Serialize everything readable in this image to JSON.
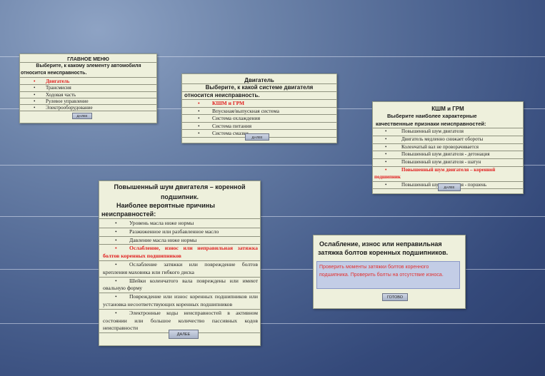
{
  "main_menu": {
    "title": "ГЛАВНОЕ МЕНЮ",
    "prompt_line1": "Выберите, к какому элементу автомобиля",
    "prompt_line2": "относится неисправность.",
    "items": [
      "Двигатель",
      "Трансмисия",
      "Ходовая часть",
      "Рулевое управление",
      "Электрооборудование"
    ],
    "next_button": "ДАЛЕЕ"
  },
  "engine_menu": {
    "title": "Двигатель",
    "prompt_line1": "Выберите, к какой системе двигателя",
    "prompt_line2": "относится неисправность.",
    "items": [
      "КШМ и ГРМ",
      "Впускная/выпускная система",
      "Система охлаждения",
      "Система питания",
      "Система смазки"
    ],
    "next_button": "ДАЛЕЕ"
  },
  "kshm_menu": {
    "title": "КШМ и ГРМ",
    "prompt_line1": "Выберите наиболее характерные",
    "prompt_line2": "качественные признаки неисправностей:",
    "items": [
      "Повышенный шум двигателя",
      "Двигатель медленно снижает обороты",
      "Коленчатый вал не проворачивается",
      "Повышенный шум двигателя - детонация",
      "Повышенный шум двигателя - шатун",
      "Повышенный шум двигателя – коренной подшипник",
      "Повышенный шум двигателя - поршень"
    ],
    "next_button": "ДАЛЕЕ"
  },
  "causes_menu": {
    "title_line1": "Повышенный шум двигателя – коренной",
    "title_line2": "подшипник.",
    "prompt_line1": "Наиболее вероятные причины",
    "prompt_line2": "неисправностей:",
    "items": [
      "Уровень масла ниже нормы",
      "Разжиженное или разбавленное масло",
      "Давление масла ниже нормы",
      "Ослабление, износ или неправильная затяжка болтов коренных подшипников",
      "Ослабление затяжки или повреждение болтов крепления маховика или гибкого диска",
      "Шейки коленчатого вала повреждены или имеют овальную форму",
      "Повреждение или износ коренных подшипников или установка несоответствующих коренных подшипников",
      "Электронные коды неисправностей в активном состоянии или большое количество пассивных кодов неисправности"
    ],
    "next_button": "ДАЛЕЕ"
  },
  "solution": {
    "title_line1": "Ослабление, износ или неправильная",
    "title_line2": "затяжка болтов коренных подшипников.",
    "answer": "Проверить моменты затяжки болтов коренного подшипника. Проверить болты на отсутствие износа.",
    "done_button": "ГОТОВО"
  },
  "colors": {
    "selected": "#e01c1c",
    "panel": "#eef0dc"
  }
}
